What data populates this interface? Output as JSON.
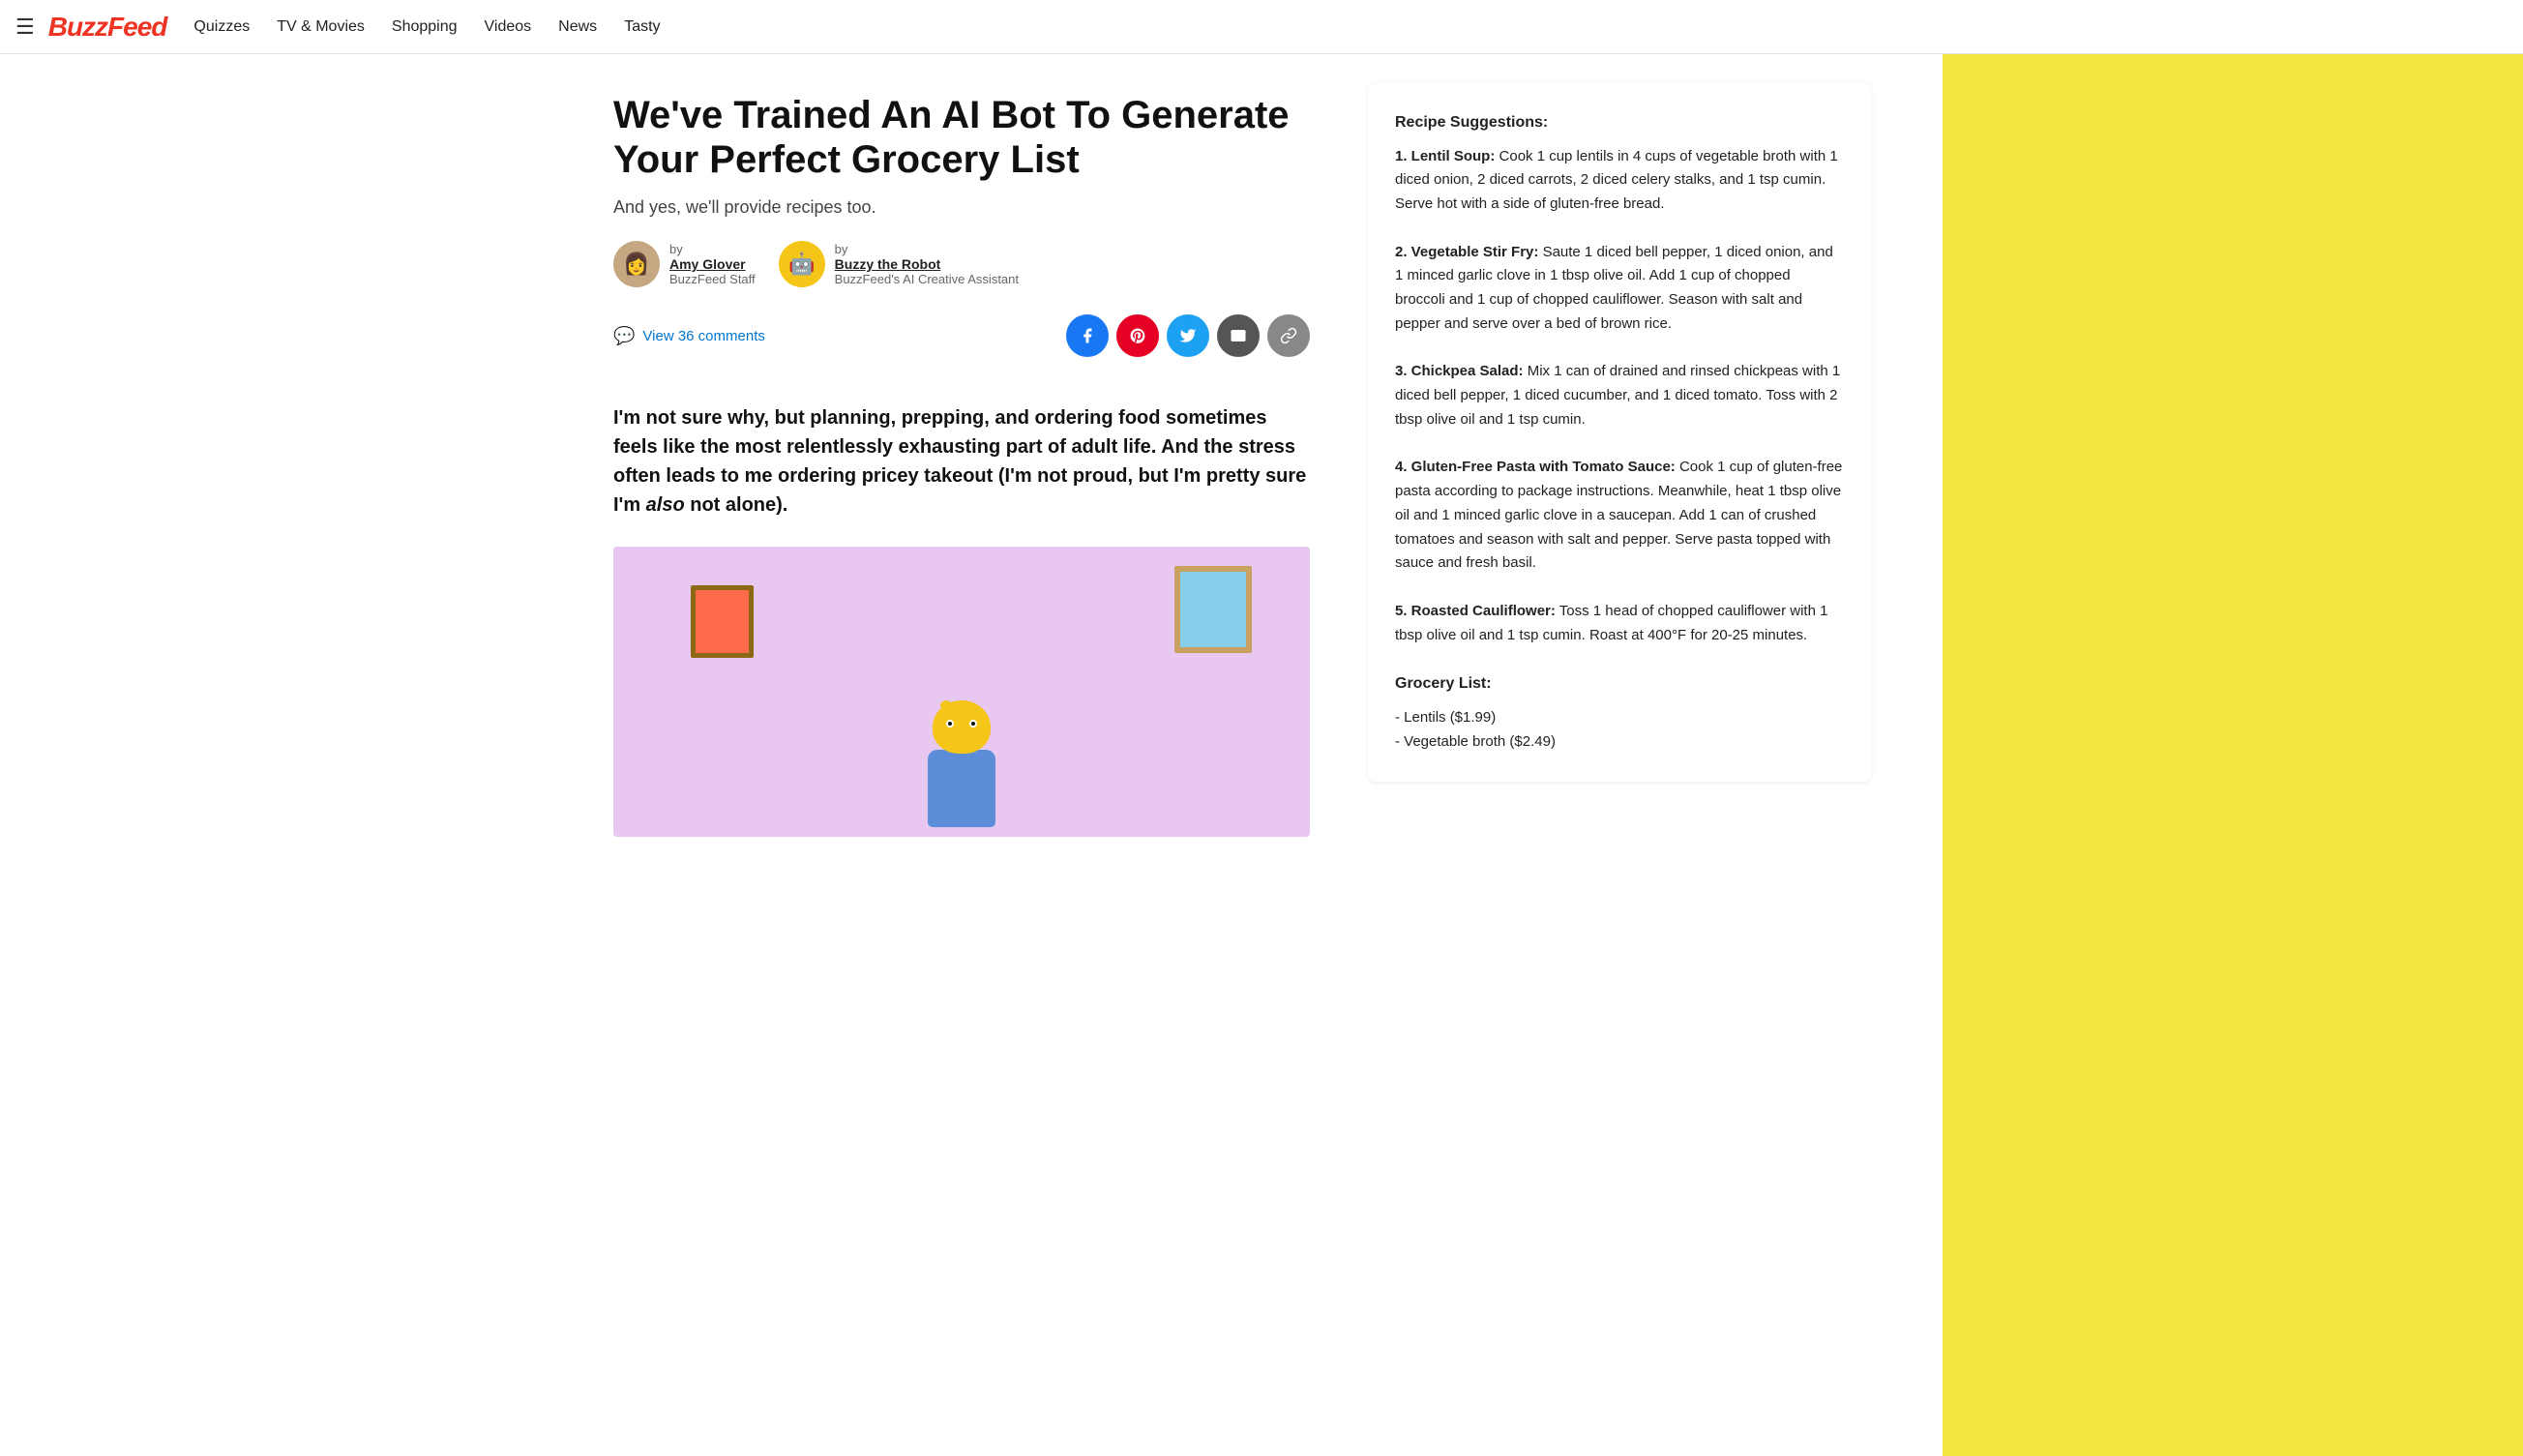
{
  "header": {
    "logo": "BuzzFeed",
    "hamburger": "☰",
    "nav": [
      {
        "label": "Quizzes",
        "href": "#"
      },
      {
        "label": "TV & Movies",
        "href": "#"
      },
      {
        "label": "Shopping",
        "href": "#"
      },
      {
        "label": "Videos",
        "href": "#"
      },
      {
        "label": "News",
        "href": "#"
      },
      {
        "label": "Tasty",
        "href": "#"
      }
    ]
  },
  "article": {
    "title": "We've Trained An AI Bot To Generate Your Perfect Grocery List",
    "subtitle": "And yes, we'll provide recipes too.",
    "author1": {
      "by": "by",
      "name": "Amy Glover",
      "role": "BuzzFeed Staff"
    },
    "author2": {
      "by": "by",
      "name": "Buzzy the Robot",
      "role": "BuzzFeed's AI Creative Assistant"
    },
    "comments_label": "View 36 comments",
    "body_lead": "I'm not sure why, but planning, prepping, and ordering food sometimes feels like the most relentlessly exhausting part of adult life. And the stress often leads to me ordering pricey takeout (I'm not proud, but I'm pretty sure I'm ",
    "body_lead_italic": "also",
    "body_lead_end": " not alone).",
    "share_buttons": [
      {
        "platform": "facebook",
        "icon": "f",
        "label": "Share on Facebook"
      },
      {
        "platform": "pinterest",
        "icon": "P",
        "label": "Share on Pinterest"
      },
      {
        "platform": "twitter",
        "icon": "t",
        "label": "Share on Twitter"
      },
      {
        "platform": "email",
        "icon": "✉",
        "label": "Share via Email"
      },
      {
        "platform": "link",
        "icon": "🔗",
        "label": "Copy Link"
      }
    ]
  },
  "sidebar": {
    "recipe_suggestions_title": "Recipe Suggestions:",
    "recipe1_title": "1. Lentil Soup:",
    "recipe1_text": "Cook 1 cup lentils in 4 cups of vegetable broth with 1 diced onion, 2 diced carrots, 2 diced celery stalks, and 1 tsp cumin. Serve hot with a side of gluten-free bread.",
    "recipe2_title": "2. Vegetable Stir Fry:",
    "recipe2_text": "Saute 1 diced bell pepper, 1 diced onion, and 1 minced garlic clove in 1 tbsp olive oil. Add 1 cup of chopped broccoli and 1 cup of chopped cauliflower. Season with salt and pepper and serve over a bed of brown rice.",
    "recipe3_title": "3. Chickpea Salad:",
    "recipe3_text": "Mix 1 can of drained and rinsed chickpeas with 1 diced bell pepper, 1 diced cucumber, and 1 diced tomato. Toss with 2 tbsp olive oil and 1 tsp cumin.",
    "recipe4_title": "4. Gluten-Free Pasta with Tomato Sauce:",
    "recipe4_text": "Cook 1 cup of gluten-free pasta according to package instructions. Meanwhile, heat 1 tbsp olive oil and 1 minced garlic clove in a saucepan. Add 1 can of crushed tomatoes and season with salt and pepper. Serve pasta topped with sauce and fresh basil.",
    "recipe5_title": "5. Roasted Cauliflower:",
    "recipe5_text": "Toss 1 head of chopped cauliflower with 1 tbsp olive oil and 1 tsp cumin. Roast at 400°F for 20-25 minutes.",
    "grocery_list_title": "Grocery List:",
    "grocery_item1": "- Lentils ($1.99)",
    "grocery_item2": "- Vegetable broth ($2.49)"
  }
}
